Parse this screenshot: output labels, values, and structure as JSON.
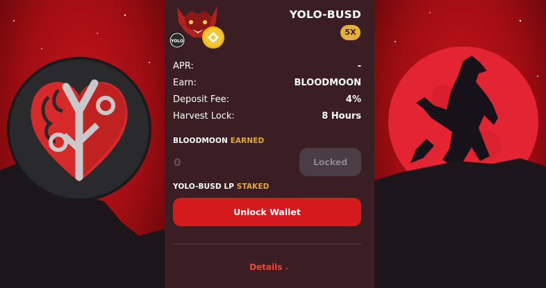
{
  "farm": {
    "pair": "YOLO-BUSD",
    "multiplier": "5X",
    "token_badge_text": "YOLO",
    "details": [
      {
        "label": "APR:",
        "value": "-"
      },
      {
        "label": "Earn:",
        "value": "BLOODMOON"
      },
      {
        "label": "Deposit Fee:",
        "value": "4%"
      },
      {
        "label": "Harvest Lock:",
        "value": "8 Hours"
      }
    ],
    "earned": {
      "token": "BLOODMOON",
      "suffix": "EARNED",
      "value": "0"
    },
    "locked_label": "Locked",
    "staked": {
      "token": "YOLO-BUSD LP",
      "suffix": "STAKED"
    },
    "unlock_label": "Unlock Wallet",
    "details_label": "Details"
  },
  "colors": {
    "card_bg": "#3a1e23",
    "accent_gold": "#e3a93a",
    "primary_red": "#d51a1d",
    "details_link": "#e84a2c",
    "background_red": "#b0111a"
  },
  "icons": {
    "left_art": "yolo-heart-logo",
    "right_art": "werewolf-moon",
    "farm_icon": "wolf-mascot",
    "busd_token": "busd-token",
    "expand": "chevron-down"
  }
}
